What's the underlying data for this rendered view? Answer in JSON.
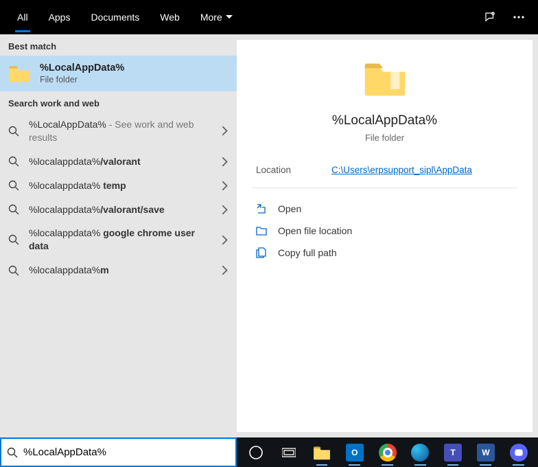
{
  "tabs": {
    "all": "All",
    "apps": "Apps",
    "documents": "Documents",
    "web": "Web",
    "more": "More"
  },
  "left": {
    "bestHdr": "Best match",
    "best": {
      "title": "%LocalAppData%",
      "sub": "File folder"
    },
    "swwHdr": "Search work and web",
    "rows": [
      {
        "prefix": "%LocalAppData%",
        "bold": "",
        "suffix": " - See work and web results"
      },
      {
        "prefix": "%localappdata%",
        "bold": "/valorant",
        "suffix": ""
      },
      {
        "prefix": "%localappdata% ",
        "bold": "temp",
        "suffix": ""
      },
      {
        "prefix": "%localappdata%",
        "bold": "/valorant/save",
        "suffix": ""
      },
      {
        "prefix": "%localappdata% ",
        "bold": "google chrome user data",
        "suffix": ""
      },
      {
        "prefix": "%localappdata%",
        "bold": "m",
        "suffix": ""
      }
    ]
  },
  "preview": {
    "title": "%LocalAppData%",
    "sub": "File folder",
    "locLabel": "Location",
    "locValue": "C:\\Users\\erpsupport_sipl\\AppData",
    "actions": {
      "open": "Open",
      "openLoc": "Open file location",
      "copy": "Copy full path"
    }
  },
  "search": {
    "value": "%LocalAppData%"
  },
  "taskbar": {
    "items": [
      {
        "name": "cortana",
        "bg": "#101318",
        "ring": true
      },
      {
        "name": "taskview",
        "bg": "#101318"
      },
      {
        "name": "explorer",
        "bg": "#ffcc4d",
        "running": true
      },
      {
        "name": "outlook",
        "bg": "#0072c6",
        "txt": "O",
        "running": true
      },
      {
        "name": "chrome",
        "bg": "",
        "chrome": true,
        "running": true
      },
      {
        "name": "edge",
        "bg": "",
        "edge": true,
        "running": true
      },
      {
        "name": "teams",
        "bg": "#464eb8",
        "txt": "T",
        "running": true
      },
      {
        "name": "word",
        "bg": "#2b579a",
        "txt": "W",
        "running": true
      },
      {
        "name": "discord",
        "bg": "#5865f2",
        "running": true
      }
    ]
  }
}
